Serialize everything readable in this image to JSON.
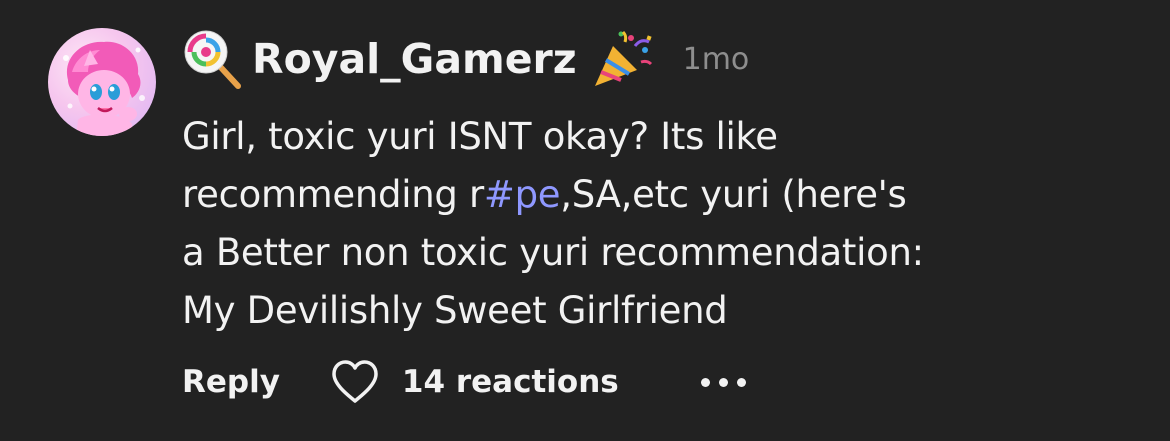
{
  "comment": {
    "avatar_icon": "pony-avatar",
    "username": "Royal_Gamerz",
    "username_prefix_icon": "lollipop-icon",
    "username_suffix_icon": "party-popper-icon",
    "timestamp": "1mo",
    "body": {
      "line1": "Girl, toxic yuri ISNT okay? Its like",
      "line2_before": "recommending r",
      "line2_hashtag": "#pe",
      "line2_after": ",SA,etc yuri (here's",
      "line3": "a Better non toxic yuri recommendation:",
      "line4": "My Devilishly Sweet Girlfriend"
    },
    "hashtag_color": "#8f98ff"
  },
  "actions": {
    "reply_label": "Reply",
    "heart_icon": "heart-icon",
    "reactions_label": "14 reactions",
    "more_icon": "more-dots-icon"
  }
}
